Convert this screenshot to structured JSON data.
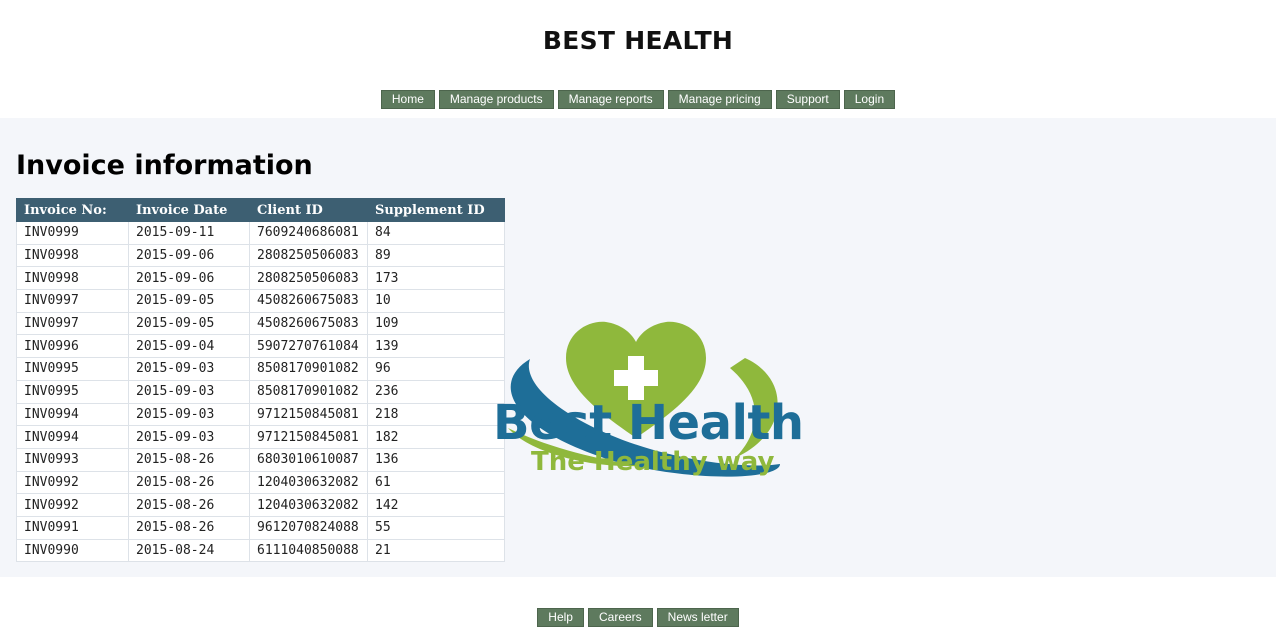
{
  "header": {
    "title": "BEST HEALTH"
  },
  "nav": {
    "items": [
      {
        "label": "Home"
      },
      {
        "label": "Manage products"
      },
      {
        "label": "Manage reports"
      },
      {
        "label": "Manage pricing"
      },
      {
        "label": "Support"
      },
      {
        "label": "Login"
      }
    ]
  },
  "main": {
    "title": "Invoice information",
    "table": {
      "columns": [
        "Invoice No:",
        "Invoice Date",
        "Client ID",
        "Supplement ID"
      ],
      "rows": [
        [
          "INV0999",
          "2015-09-11",
          "7609240686081",
          "84"
        ],
        [
          "INV0998",
          "2015-09-06",
          "2808250506083",
          "89"
        ],
        [
          "INV0998",
          "2015-09-06",
          "2808250506083",
          "173"
        ],
        [
          "INV0997",
          "2015-09-05",
          "4508260675083",
          "10"
        ],
        [
          "INV0997",
          "2015-09-05",
          "4508260675083",
          "109"
        ],
        [
          "INV0996",
          "2015-09-04",
          "5907270761084",
          "139"
        ],
        [
          "INV0995",
          "2015-09-03",
          "8508170901082",
          "96"
        ],
        [
          "INV0995",
          "2015-09-03",
          "8508170901082",
          "236"
        ],
        [
          "INV0994",
          "2015-09-03",
          "9712150845081",
          "218"
        ],
        [
          "INV0994",
          "2015-09-03",
          "9712150845081",
          "182"
        ],
        [
          "INV0993",
          "2015-08-26",
          "6803010610087",
          "136"
        ],
        [
          "INV0992",
          "2015-08-26",
          "1204030632082",
          "61"
        ],
        [
          "INV0992",
          "2015-08-26",
          "1204030632082",
          "142"
        ],
        [
          "INV0991",
          "2015-08-26",
          "9612070824088",
          "55"
        ],
        [
          "INV0990",
          "2015-08-24",
          "6111040850088",
          "21"
        ]
      ]
    },
    "logo": {
      "brand_name": "Best Health",
      "tagline": "The Healthy way",
      "icon": "heart-cross-orbit-logo",
      "colors": {
        "blue": "#1e6e98",
        "green": "#8fb83c"
      }
    }
  },
  "footer": {
    "items": [
      {
        "label": "Help"
      },
      {
        "label": "Careers"
      },
      {
        "label": "News letter"
      }
    ]
  },
  "colors": {
    "nav_button": "#5e7a5e",
    "table_header": "#3d5f72",
    "main_background": "#f4f6fa"
  }
}
